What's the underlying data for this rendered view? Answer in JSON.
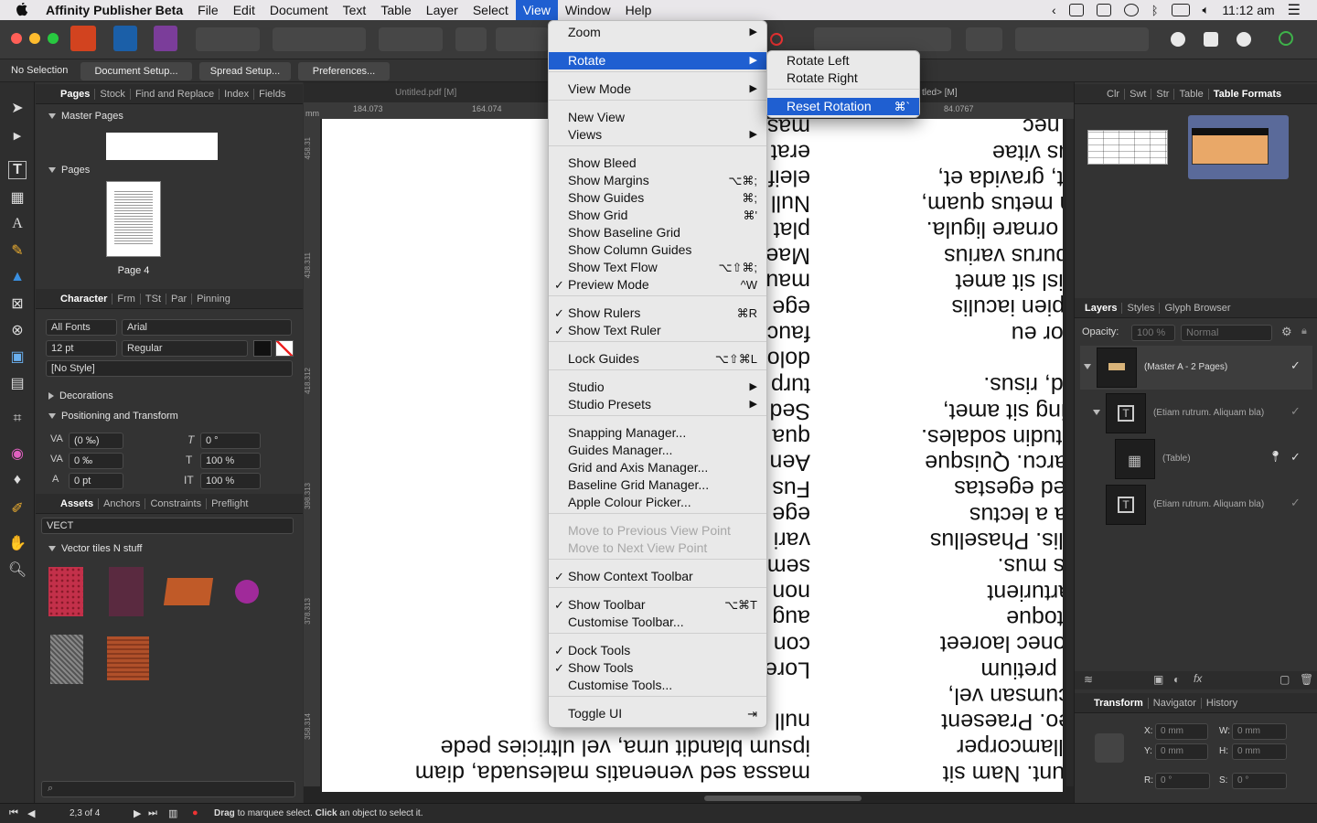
{
  "menubar": {
    "app": "Affinity Publisher Beta",
    "items": [
      "File",
      "Edit",
      "Document",
      "Text",
      "Table",
      "Layer",
      "Select",
      "View",
      "Window",
      "Help"
    ],
    "active": "View",
    "clock": "11:12 am"
  },
  "context_toolbar": {
    "selection": "No Selection",
    "buttons": [
      "Document Setup...",
      "Spread Setup...",
      "Preferences..."
    ]
  },
  "pages_panel": {
    "tabs": [
      "Pages",
      "Stock",
      "Find and Replace",
      "Index",
      "Fields"
    ],
    "master_pages_label": "Master Pages",
    "pages_label": "Pages",
    "page_caption": "Page 4"
  },
  "character_panel": {
    "tabs": [
      "Character",
      "Frm",
      "TSt",
      "Par",
      "Pinning"
    ],
    "font_collection": "All Fonts",
    "font_family": "Arial",
    "font_size": "12 pt",
    "font_style": "Regular",
    "style": "[No Style]",
    "decorations_label": "Decorations",
    "positioning_label": "Positioning and Transform",
    "kerning": "(0 ‰)",
    "tracking": "0 ‰",
    "baseline": "0 pt",
    "shear": "0 °",
    "scale_h": "100 %",
    "scale_v": "100 %"
  },
  "assets_panel": {
    "tabs": [
      "Assets",
      "Anchors",
      "Constraints",
      "Preflight"
    ],
    "category": "VECT",
    "group": "Vector tiles N stuff"
  },
  "document": {
    "tab_left": "Untitled.pdf [M]",
    "tab_right": "tled> [M]",
    "ruler_unit": "mm",
    "ruler_marks": [
      "184.073",
      "164.074",
      "84.0767"
    ],
    "vruler_marks": [
      "458.31",
      "438.311",
      "418.312",
      "398.313",
      "378.313",
      "358.314"
    ],
    "left_column": [
      "massa sed venenatis malesuada, diam",
      "ipsum blandit urna, vel ultricies pede",
      "null",
      "",
      "Lore                         met,",
      "con         elit. Quisque in",
      "aug         magna",
      "non        blandit imperdiet",
      "sem        , urna sit amet",
      "vari        tor laoreet turpis,",
      "ege         ac sapien.",
      "Fus        ger sed risus.",
      "Aen        acilisis egestas",
      "qua        ugue  id mauris.",
      "Sed        ursus fringilla,",
      "turp        cu, eu varius",
      "dolo       n ipsum,",
      "fauc       stique, porta",
      "ege        endrerit diam et",
      "mau        c euismod dui.",
      "Mae        ac habitasse",
      "plat       ndisse id massa.",
      "Null       cus. Duis",
      "eleif       od lacinia, felis",
      "erat       ongue leo velit a",
      "mas        to a turpis"
    ],
    "right_column": [
      "us quis odio sit",
      "ncidunt. Nam sit",
      "us ullamcorper",
      "se leo. Praesent",
      ", accumsan vel,",
      "lorbi pretium",
      "s. Donec laoreet",
      "s natoque",
      "is parturient",
      "culus mus.",
      "id felis. Phasellus",
      "Nulla a lectus",
      "n. Sed egestas",
      "are arcu. Quisque",
      "ollicitudin sodales.",
      "piscing sit amet,",
      "smod, risus.",
      "",
      ", dolor eu",
      "s sapien iaculis",
      "us nisl sit amet",
      "tae purus varius",
      "attis ornare ligula.",
      "illum metus quam,",
      "idunt, gravida et,",
      "lectus vitae",
      "felis nec"
    ]
  },
  "right_panels": {
    "top_tabs": [
      "Clr",
      "Swt",
      "Str",
      "Table",
      "Table Formats"
    ],
    "layer_tabs": [
      "Layers",
      "Styles",
      "Glyph Browser"
    ],
    "opacity_label": "Opacity:",
    "opacity_value": "100 %",
    "blend_mode": "Normal",
    "layers": [
      {
        "name": "(Master A - 2 Pages)"
      },
      {
        "name": "(Etiam rutrum. Aliquam bla)"
      },
      {
        "name": "(Table)"
      },
      {
        "name": "(Etiam rutrum. Aliquam bla)"
      }
    ],
    "transform_tabs": [
      "Transform",
      "Navigator",
      "History"
    ],
    "x": "0 mm",
    "y": "0 mm",
    "w": "0 mm",
    "h": "0 mm",
    "r": "0 °",
    "s": "0 °",
    "labels": {
      "x": "X:",
      "y": "Y:",
      "w": "W:",
      "h": "H:",
      "r": "R:",
      "s": "S:"
    }
  },
  "statusbar": {
    "page_indicator": "2,3 of 4",
    "hint_drag": "Drag",
    "hint_mid": " to marquee select. ",
    "hint_click": "Click",
    "hint_end": " an object to select it."
  },
  "view_menu": [
    {
      "label": "Zoom",
      "submenu": true
    },
    {
      "label": "Rotate",
      "submenu": true,
      "highlighted": true
    },
    {
      "label": "View Mode",
      "submenu": true
    },
    {
      "label": "New View"
    },
    {
      "label": "Views",
      "submenu": true
    },
    {
      "label": "Show Bleed"
    },
    {
      "label": "Show Margins",
      "shortcut": "⌥⌘;"
    },
    {
      "label": "Show Guides",
      "shortcut": "⌘;"
    },
    {
      "label": "Show Grid",
      "shortcut": "⌘'"
    },
    {
      "label": "Show Baseline Grid"
    },
    {
      "label": "Show Column Guides"
    },
    {
      "label": "Show Text Flow",
      "shortcut": "⌥⇧⌘;"
    },
    {
      "label": "Preview Mode",
      "shortcut": "^W",
      "checked": true
    },
    {
      "label": "Show Rulers",
      "shortcut": "⌘R",
      "checked": true
    },
    {
      "label": "Show Text Ruler",
      "checked": true
    },
    {
      "label": "Lock Guides",
      "shortcut": "⌥⇧⌘L"
    },
    {
      "label": "Studio",
      "submenu": true
    },
    {
      "label": "Studio Presets",
      "submenu": true
    },
    {
      "label": "Snapping Manager..."
    },
    {
      "label": "Guides Manager..."
    },
    {
      "label": "Grid and Axis Manager..."
    },
    {
      "label": "Baseline Grid Manager..."
    },
    {
      "label": "Apple Colour Picker..."
    },
    {
      "label": "Move to Previous View Point",
      "disabled": true
    },
    {
      "label": "Move to Next View Point",
      "disabled": true
    },
    {
      "label": "Show Context Toolbar",
      "checked": true
    },
    {
      "label": "Show Toolbar",
      "shortcut": "⌥⌘T",
      "checked": true
    },
    {
      "label": "Customise Toolbar..."
    },
    {
      "label": "Dock Tools",
      "checked": true
    },
    {
      "label": "Show Tools",
      "checked": true
    },
    {
      "label": "Customise Tools..."
    },
    {
      "label": "Toggle UI",
      "shortcut": "⇥"
    }
  ],
  "rotate_submenu": [
    {
      "label": "Rotate Left"
    },
    {
      "label": "Rotate Right"
    },
    {
      "label": "Reset Rotation",
      "shortcut": "⌘`",
      "highlighted": true
    }
  ]
}
